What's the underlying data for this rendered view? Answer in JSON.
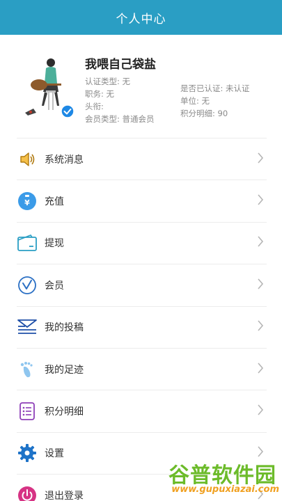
{
  "header": {
    "title": "个人中心"
  },
  "profile": {
    "name": "我喂自己袋盐",
    "cert_type": "认证类型: 无",
    "position": "职务: 无",
    "title": "头衔:",
    "member_type": "会员类型: 普通会员",
    "verified": "是否已认证: 未认证",
    "unit": "单位: 无",
    "points": "积分明细: 90"
  },
  "menu": [
    {
      "label": "系统消息",
      "icon": "speaker-icon"
    },
    {
      "label": "充值",
      "icon": "recharge-icon"
    },
    {
      "label": "提现",
      "icon": "wallet-icon"
    },
    {
      "label": "会员",
      "icon": "member-icon"
    },
    {
      "label": "我的投稿",
      "icon": "submission-icon"
    },
    {
      "label": "我的足迹",
      "icon": "footprint-icon"
    },
    {
      "label": "积分明细",
      "icon": "points-list-icon"
    },
    {
      "label": "设置",
      "icon": "gear-icon"
    },
    {
      "label": "退出登录",
      "icon": "power-icon"
    }
  ],
  "watermark": {
    "title": "谷普软件园",
    "url": "www.gupuxiazai.com"
  },
  "colors": {
    "header": "#2a9ec4",
    "accent_blue": "#1e88e5",
    "orange": "#f5a623",
    "purple": "#8e3fb8",
    "pink": "#d63384"
  }
}
